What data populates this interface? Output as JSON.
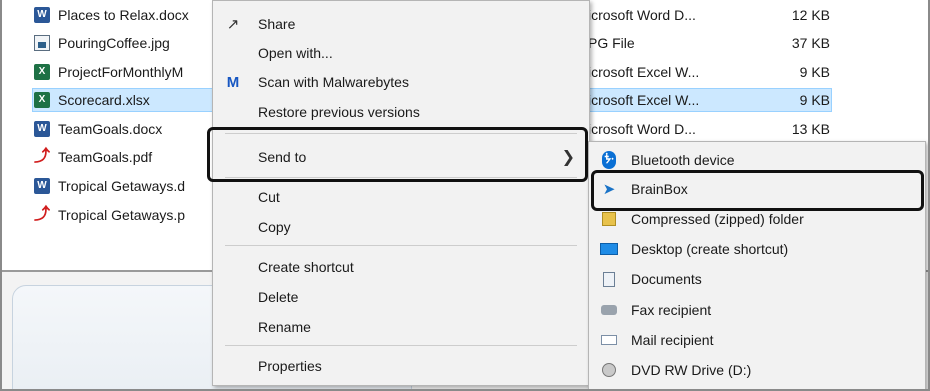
{
  "files": [
    {
      "name": "Places to Relax.docx",
      "icon": "word-doc-icon",
      "type": "Microsoft Word D...",
      "size": "12 KB"
    },
    {
      "name": "PouringCoffee.jpg",
      "icon": "jpg-file-icon",
      "type": "JPG File",
      "size": "37 KB"
    },
    {
      "name": "ProjectForMonthlyM",
      "icon": "excel-file-icon",
      "type": "Microsoft Excel W...",
      "size": "9 KB"
    },
    {
      "name": "Scorecard.xlsx",
      "icon": "excel-file-icon",
      "type": "Microsoft Excel W...",
      "size": "9 KB",
      "selected": true
    },
    {
      "name": "TeamGoals.docx",
      "icon": "word-doc-icon",
      "type": "Microsoft Word D...",
      "size": "13 KB"
    },
    {
      "name": "TeamGoals.pdf",
      "icon": "pdf-file-icon"
    },
    {
      "name": "Tropical Getaways.d",
      "icon": "word-doc-icon"
    },
    {
      "name": "Tropical Getaways.p",
      "icon": "pdf-file-icon"
    }
  ],
  "visible_types": [
    "icrosoft Word D...",
    "PG File",
    "icrosoft Excel W...",
    "icrosoft Excel W...",
    "icrosoft Word D..."
  ],
  "context_menu": {
    "items": [
      {
        "label": "Share",
        "icon": "share-icon"
      },
      {
        "label": "Open with..."
      },
      {
        "label": "Scan with Malwarebytes",
        "icon": "malwarebytes-icon"
      },
      {
        "label": "Restore previous versions"
      },
      {
        "label": "Send to",
        "has_submenu": true,
        "highlighted": true
      },
      {
        "label": "Cut"
      },
      {
        "label": "Copy"
      },
      {
        "label": "Create shortcut"
      },
      {
        "label": "Delete"
      },
      {
        "label": "Rename"
      },
      {
        "label": "Properties"
      }
    ]
  },
  "send_to_menu": {
    "items": [
      {
        "label": "Bluetooth device",
        "icon": "bluetooth-icon"
      },
      {
        "label": "BrainBox",
        "icon": "brainbox-icon",
        "highlighted": true
      },
      {
        "label": "Compressed (zipped) folder",
        "icon": "zip-folder-icon"
      },
      {
        "label": "Desktop (create shortcut)",
        "icon": "desktop-icon"
      },
      {
        "label": "Documents",
        "icon": "documents-icon"
      },
      {
        "label": "Fax recipient",
        "icon": "fax-icon"
      },
      {
        "label": "Mail recipient",
        "icon": "mail-icon"
      },
      {
        "label": "DVD RW Drive (D:)",
        "icon": "dvd-drive-icon"
      }
    ]
  },
  "colors": {
    "selection": "#cce8ff",
    "menu_bg": "#f2f2f2",
    "highlight_border": "#111111"
  }
}
